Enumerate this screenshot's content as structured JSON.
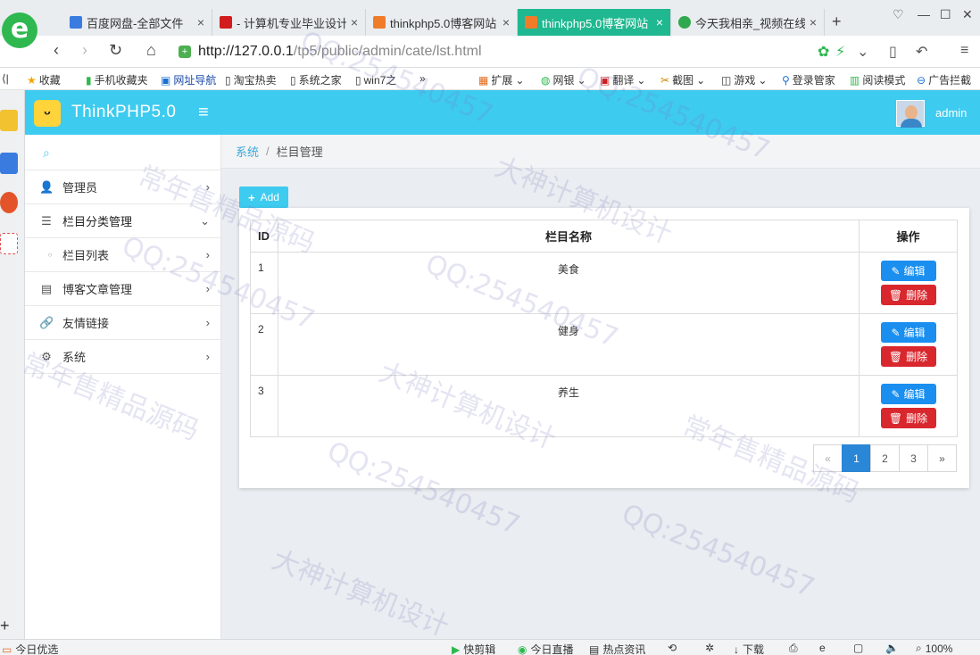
{
  "browser": {
    "tabs": [
      {
        "title": "百度网盘-全部文件",
        "fav_color": "#3a7be0"
      },
      {
        "title": "- 计算机专业毕业设计",
        "fav_color": "#d11d1d"
      },
      {
        "title": "thinkphp5.0博客网站",
        "fav_color": "#f07c2a"
      },
      {
        "title": "thinkphp5.0博客网站",
        "fav_color": "#f07c2a"
      },
      {
        "title": "今天我相亲_视频在线",
        "fav_color": "#2fa84f"
      }
    ],
    "active_tab": 3,
    "tab_close": "×",
    "new_tab": "+",
    "url_host": "http://127.0.0.1",
    "url_path": "/tp5/public/admin/cate/lst.html",
    "bookmarks": [
      "收藏",
      "手机收藏夹",
      "网址导航",
      "淘宝热卖",
      "系统之家",
      "win7之",
      "»"
    ],
    "bookmarks_right": [
      "扩展",
      "网银",
      "翻译",
      "截图",
      "游戏",
      "登录管家",
      "阅读模式",
      "广告拦截"
    ],
    "status": {
      "left": "今日优选",
      "items": [
        "快剪辑",
        "今日直播",
        "热点资讯",
        "下载",
        "100%"
      ]
    }
  },
  "app": {
    "title": "ThinkPHP5.0",
    "user": "admin",
    "menu": [
      {
        "label": "管理员",
        "icon": "user-icon",
        "glyph": "👤",
        "arrow": "›"
      },
      {
        "label": "栏目分类管理",
        "icon": "list-icon",
        "glyph": "☰",
        "arrow": "⌄"
      },
      {
        "label": "栏目列表",
        "icon": "dot-icon",
        "glyph": "○",
        "arrow": "›"
      },
      {
        "label": "博客文章管理",
        "icon": "file-icon",
        "glyph": "▤",
        "arrow": "›"
      },
      {
        "label": "友情链接",
        "icon": "link-icon",
        "glyph": "🔗",
        "arrow": "›"
      },
      {
        "label": "系统",
        "icon": "gear-icon",
        "glyph": "⚙",
        "arrow": "›"
      }
    ],
    "breadcrumb": {
      "root": "系统",
      "separator": "/",
      "current": "栏目管理"
    },
    "add_label": "Add",
    "table": {
      "headers": [
        "ID",
        "栏目名称",
        "操作"
      ],
      "rows": [
        {
          "id": "1",
          "name": "美食"
        },
        {
          "id": "2",
          "name": "健身"
        },
        {
          "id": "3",
          "name": "养生"
        }
      ],
      "edit_label": "编辑",
      "delete_label": "删除"
    },
    "pagination": {
      "prev": "«",
      "pages": [
        "1",
        "2",
        "3"
      ],
      "next": "»",
      "current": "1"
    }
  },
  "watermarks": [
    "QQ:254540457",
    "大神计算机设计",
    "常年售精品源码"
  ]
}
